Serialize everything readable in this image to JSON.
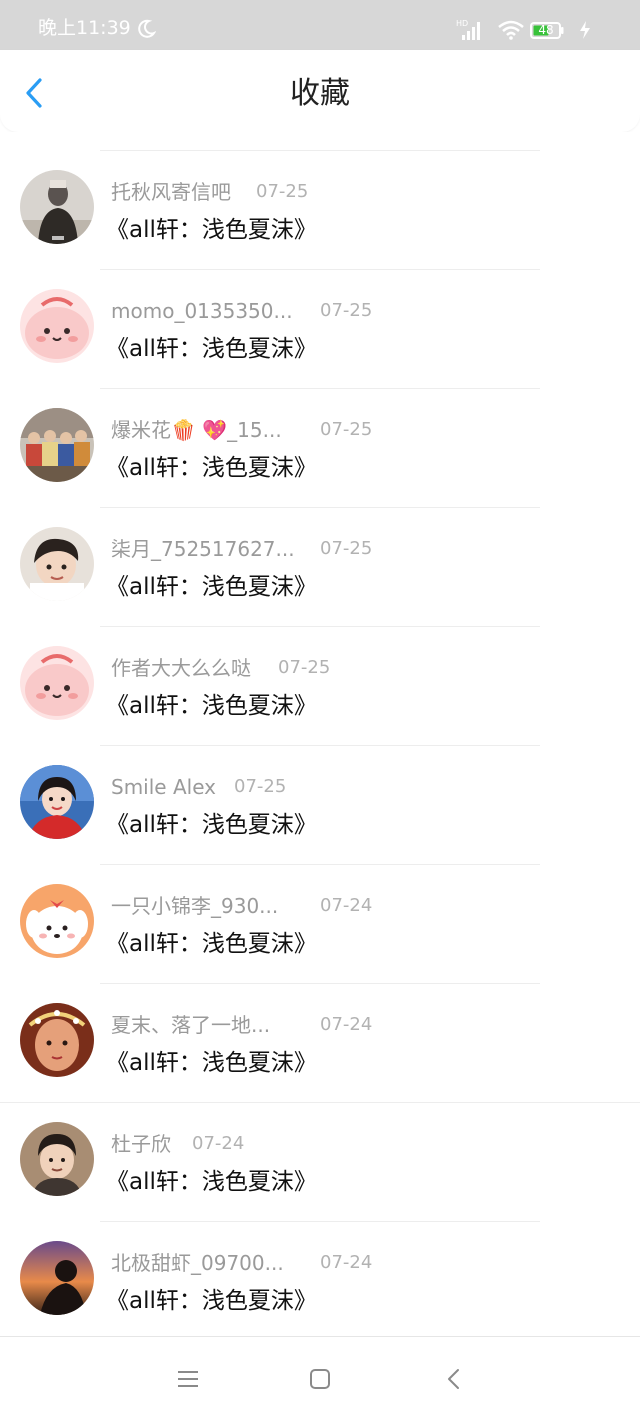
{
  "status_bar": {
    "time": "晚上11:39",
    "signal_tag": "HD",
    "battery_level": "48",
    "icons": [
      "moon-icon",
      "signal-icon",
      "wifi-icon",
      "battery-icon",
      "charging-icon"
    ]
  },
  "header": {
    "title": "收藏",
    "back_icon": "chevron-left-icon",
    "accent_color": "#2a9df4"
  },
  "items": [
    {
      "name": "托秋风寄信吧",
      "date": "07-25",
      "title": "《all轩：浅色夏沫》",
      "avatar": "person-dark-coat"
    },
    {
      "name": "momo_0135350...",
      "date": "07-25",
      "title": "《all轩：浅色夏沫》",
      "avatar": "pink-blob-cartoon"
    },
    {
      "name": "爆米花🍿 💖_15...",
      "date": "07-25",
      "title": "《all轩：浅色夏沫》",
      "avatar": "group-photo"
    },
    {
      "name": "柒月_752517627...",
      "date": "07-25",
      "title": "《all轩：浅色夏沫》",
      "avatar": "short-hair-portrait"
    },
    {
      "name": "作者大大么么哒",
      "date": "07-25",
      "title": "《all轩：浅色夏沫》",
      "avatar": "pink-blob-cartoon"
    },
    {
      "name": "Smile Alex",
      "date": "07-25",
      "title": "《all轩：浅色夏沫》",
      "avatar": "girl-red-blue"
    },
    {
      "name": "一只小锦李_930...",
      "date": "07-24",
      "title": "《all轩：浅色夏沫》",
      "avatar": "white-dog-cartoon"
    },
    {
      "name": "夏末、落了一地...",
      "date": "07-24",
      "title": "《all轩：浅色夏沫》",
      "avatar": "flower-crown-portrait"
    },
    {
      "name": "杜子欣",
      "date": "07-24",
      "title": "《all轩：浅色夏沫》",
      "avatar": "boy-portrait"
    },
    {
      "name": "北极甜虾_09700...",
      "date": "07-24",
      "title": "《all轩：浅色夏沫》",
      "avatar": "sunset-silhouette"
    }
  ],
  "bottom_nav": {
    "icons": [
      "menu-icon",
      "home-square-icon",
      "back-triangle-icon"
    ]
  }
}
